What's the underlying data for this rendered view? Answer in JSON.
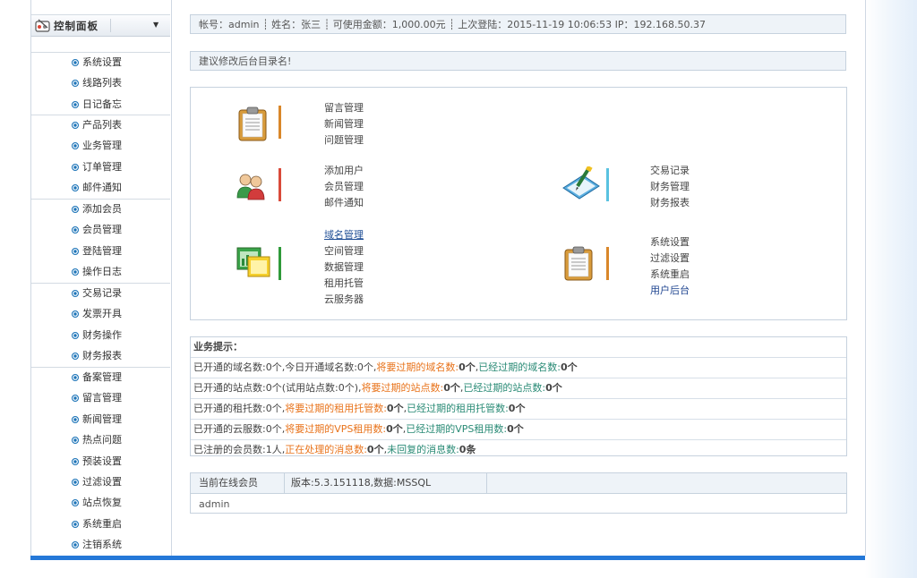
{
  "sidebar": {
    "header_title": "控制面板",
    "groups": [
      [
        "系统设置",
        "线路列表",
        "日记备忘"
      ],
      [
        "产品列表",
        "业务管理",
        "订单管理",
        "邮件通知"
      ],
      [
        "添加会员",
        "会员管理",
        "登陆管理",
        "操作日志"
      ],
      [
        "交易记录",
        "发票开具",
        "财务操作",
        "财务报表"
      ],
      [
        "备案管理",
        "留言管理",
        "新闻管理",
        "热点问题",
        "预装设置",
        "过滤设置",
        "站点恢复",
        "系统重启",
        "注销系统"
      ]
    ]
  },
  "account_bar": {
    "text": "帐号：admin ┊ 姓名：张三 ┊ 可使用金额：1,000.00元 ┊ 上次登陆：2015-11-19 10:06:53 IP：192.168.50.37"
  },
  "notice": "建议修改后台目录名!",
  "quick": {
    "messages": [
      "留言管理",
      "新闻管理",
      "问题管理"
    ],
    "users": [
      "添加用户",
      "会员管理",
      "邮件通知"
    ],
    "domains": [
      "域名管理",
      "空间管理",
      "数据管理",
      "租用托管",
      "云服务器"
    ],
    "finance": [
      "交易记录",
      "财务管理",
      "财务报表"
    ],
    "system": [
      "系统设置",
      "过滤设置",
      "系统重启",
      "用户后台"
    ]
  },
  "tips": {
    "title": "业务提示：",
    "rows": [
      [
        [
          "已开通的域名数:0个,今日开通域名数:0个,",
          ""
        ],
        [
          "将要过期的域名数:",
          "orange"
        ],
        [
          "0个",
          "b"
        ],
        [
          ",",
          ""
        ],
        [
          "已经过期的域名数:",
          "green"
        ],
        [
          "0个",
          "b"
        ]
      ],
      [
        [
          "已开通的站点数:0个(试用站点数:0个),",
          ""
        ],
        [
          "将要过期的站点数:",
          "orange"
        ],
        [
          "0个",
          "b"
        ],
        [
          ",",
          ""
        ],
        [
          "已经过期的站点数:",
          "green"
        ],
        [
          "0个",
          "b"
        ]
      ],
      [
        [
          "已开通的租托数:0个,",
          ""
        ],
        [
          "将要过期的租用托管数:",
          "orange"
        ],
        [
          "0个",
          "b"
        ],
        [
          ",",
          ""
        ],
        [
          "已经过期的租用托管数:",
          "green"
        ],
        [
          "0个",
          "b"
        ]
      ],
      [
        [
          "已开通的云服数:0个,",
          ""
        ],
        [
          "将要过期的VPS租用数:",
          "orange"
        ],
        [
          "0个",
          "b"
        ],
        [
          ",",
          ""
        ],
        [
          "已经过期的VPS租用数:",
          "green"
        ],
        [
          "0个",
          "b"
        ]
      ],
      [
        [
          "已注册的会员数:1人,",
          ""
        ],
        [
          "正在处理的消息数:",
          "orange"
        ],
        [
          "0个",
          "b"
        ],
        [
          ",",
          ""
        ],
        [
          "未回复的消息数:",
          "green"
        ],
        [
          "0条",
          "b"
        ]
      ]
    ]
  },
  "online": {
    "header_label": "当前在线会员",
    "version": "版本:5.3.151118,数据:MSSQL",
    "users": [
      "admin"
    ]
  }
}
